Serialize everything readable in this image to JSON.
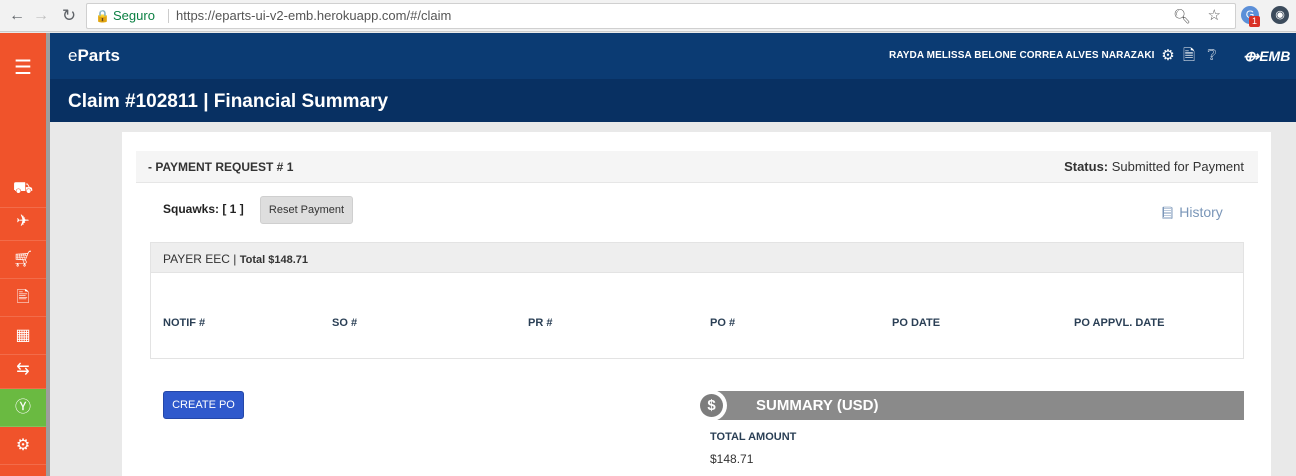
{
  "browser": {
    "back": "←",
    "forward": "→",
    "reload": "↻",
    "secure_label": "Seguro",
    "url": "https://eparts-ui-v2-emb.herokuapp.com/#/claim",
    "extension_badge": "1"
  },
  "sidebar": {
    "icons": [
      "menu-icon",
      "truck-icon",
      "plane-icon",
      "cart-icon",
      "document-icon",
      "package-icon",
      "exchange-icon",
      "dollar-icon",
      "gears-icon"
    ],
    "active": "dollar-icon",
    "colors": {
      "sidebar": "#f0532b",
      "active": "#6aba41"
    }
  },
  "header": {
    "brand_e": "e",
    "brand_rest": "Parts",
    "user_name": "RAYDA MELISSA BELONE CORREA ALVES NARAZAKI",
    "logo_text": "EMB",
    "colors": {
      "header": "#0b3b73",
      "title_bar": "#083062"
    }
  },
  "page": {
    "title": "Claim #102811 | Financial Summary"
  },
  "payment_request": {
    "title": "- PAYMENT REQUEST # 1",
    "status_label": "Status:",
    "status_value": "Submitted for Payment",
    "squawks": "Squawks: [ 1 ]",
    "reset_button": "Reset Payment",
    "history_link": "History"
  },
  "payer": {
    "label": "PAYER EEC |",
    "total": "Total $148.71",
    "columns": [
      "NOTIF #",
      "SO #",
      "PR #",
      "PO #",
      "PO DATE",
      "PO APPVL. DATE"
    ]
  },
  "actions": {
    "create_po": "CREATE PO"
  },
  "summary": {
    "icon": "$",
    "title": "SUMMARY (USD)",
    "total_amount_label": "TOTAL AMOUNT",
    "total_amount_value": "$148.71"
  }
}
